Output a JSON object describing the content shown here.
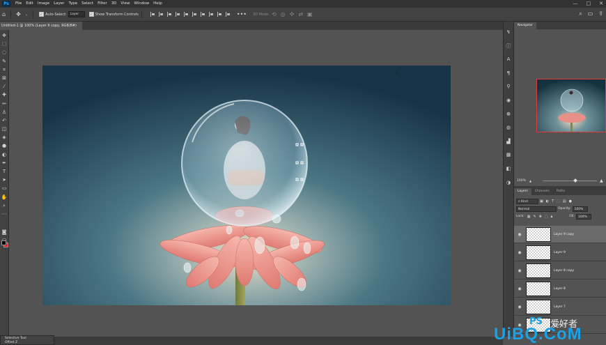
{
  "menu": {
    "logo": "Ps",
    "items": [
      "File",
      "Edit",
      "Image",
      "Layer",
      "Type",
      "Select",
      "Filter",
      "3D",
      "View",
      "Window",
      "Help"
    ],
    "window_controls": [
      "—",
      "□",
      "✕"
    ]
  },
  "options_bar": {
    "auto_select_label": "Auto-Select:",
    "auto_select_value": "Layer",
    "show_transform_label": "Show Transform Controls",
    "mode_3d_label": "3D Mode:"
  },
  "document": {
    "tab_title": "Untitled-1 @ 100% (Layer 9 copy, RGB/8#) *",
    "close": "×"
  },
  "navigator": {
    "tab": "Navigator",
    "zoom": "100%",
    "zoom_fraction": 0.6
  },
  "layers_panel": {
    "tabs": [
      "Layers",
      "Channels",
      "Paths"
    ],
    "filter_kind": "Kind",
    "blend_mode": "Normal",
    "opacity_label": "Opacity:",
    "opacity_value": "100%",
    "lock_label": "Lock:",
    "fill_label": "Fill:",
    "fill_value": "100%",
    "layers": [
      {
        "name": "Layer 9 copy",
        "selected": true
      },
      {
        "name": "Layer 9",
        "selected": false
      },
      {
        "name": "Layer 8 copy",
        "selected": false
      },
      {
        "name": "Layer 8",
        "selected": false
      },
      {
        "name": "Layer 7",
        "selected": false
      },
      {
        "name": "Layer 6",
        "selected": false
      }
    ]
  },
  "status": {
    "tool_title": "Selective Tool",
    "tool_sub": "Offset Z"
  },
  "watermark": {
    "ps": "PS",
    "cn": "爱好者",
    "site": "UiBQ.CoM"
  },
  "colors": {
    "foreground": "#000000",
    "background": "#e21b1b",
    "nav_frame": "#e03a3a",
    "watermark_blue": "#1aa1e6"
  }
}
